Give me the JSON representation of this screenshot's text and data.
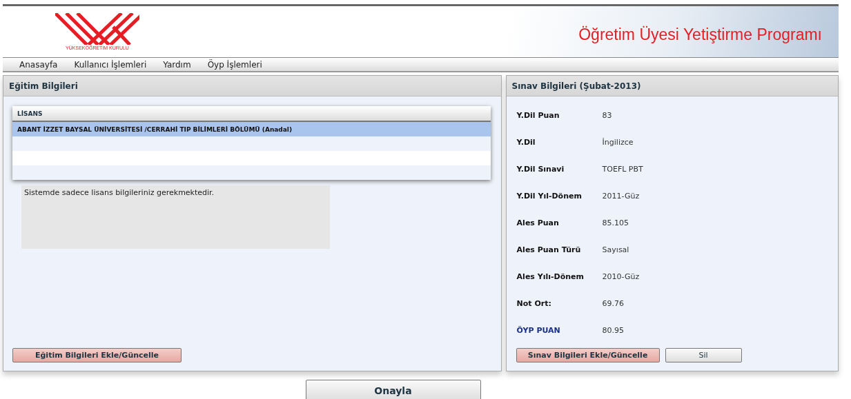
{
  "header": {
    "logo_caption": "YÜKSEKÖĞRETİM KURULU",
    "title": "Öğretim Üyesi Yetiştirme Programı"
  },
  "menu": [
    "Anasayfa",
    "Kullanıcı İşlemleri",
    "Yardım",
    "Öyp İşlemleri"
  ],
  "education": {
    "title": "Eğitim Bilgileri",
    "list_header": "LİSANS",
    "rows": [
      {
        "text": "ABANT İZZET BAYSAL ÜNİVERSİTESİ /CERRAHİ TIP BİLİMLERİ BÖLÜMÜ (Anadal)",
        "selected": true
      }
    ],
    "note": "Sistemde sadece lisans bilgileriniz gerekmektedir.",
    "buttons": [
      {
        "label": "Eğitim Bilgileri Ekle/Güncelle",
        "kind": "primary"
      }
    ]
  },
  "exam": {
    "title": "Sınav Bilgileri (Şubat-2013)",
    "fields": [
      {
        "label": "Y.Dil Puan",
        "value": "83",
        "kind": "plain"
      },
      {
        "label": "Y.Dil",
        "value": "İngilizce",
        "kind": "plain"
      },
      {
        "label": "Y.Dil Sınavi",
        "value": "TOEFL PBT",
        "kind": "plain"
      },
      {
        "label": "Y.Dil Yıl-Dönem",
        "value": "2011-Güz",
        "kind": "plain"
      },
      {
        "label": "Ales Puan",
        "value": "85.105",
        "kind": "plain"
      },
      {
        "label": "Ales Puan Türü",
        "value": "Sayısal",
        "kind": "plain"
      },
      {
        "label": "Ales Yılı-Dönem",
        "value": "2010-Güz",
        "kind": "plain"
      },
      {
        "label": "Not Ort:",
        "value": "69.76",
        "kind": "plain"
      },
      {
        "label": "ÖYP PUAN",
        "value": "80.95",
        "kind": "highlight"
      }
    ],
    "buttons": [
      {
        "label": "Sınav Bilgileri Ekle/Güncelle",
        "kind": "primary"
      },
      {
        "label": "Sil",
        "kind": "default"
      }
    ]
  },
  "footer_button": {
    "label": "Onayla",
    "kind": "default"
  }
}
